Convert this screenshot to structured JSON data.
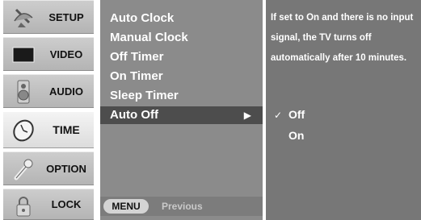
{
  "sidebar": {
    "items": [
      {
        "label": "SETUP",
        "icon": "satellite-dish-icon"
      },
      {
        "label": "VIDEO",
        "icon": "tv-screen-icon"
      },
      {
        "label": "AUDIO",
        "icon": "speaker-icon"
      },
      {
        "label": "TIME",
        "icon": "clock-icon",
        "selected": true
      },
      {
        "label": "OPTION",
        "icon": "wrench-icon"
      },
      {
        "label": "LOCK",
        "icon": "padlock-icon"
      }
    ]
  },
  "menu": {
    "items": [
      {
        "label": "Auto Clock"
      },
      {
        "label": "Manual Clock"
      },
      {
        "label": "Off Timer"
      },
      {
        "label": "On Timer"
      },
      {
        "label": "Sleep Timer"
      },
      {
        "label": "Auto Off",
        "active": true,
        "arrow": "▶"
      }
    ],
    "footer": {
      "menu_key": "MENU",
      "action": "Previous"
    }
  },
  "info": {
    "description": "If set to On and there is no input signal, the TV turns off automatically after 10 minutes.",
    "options": [
      {
        "label": "Off",
        "checked": true,
        "check_mark": "✓"
      },
      {
        "label": "On",
        "checked": false,
        "check_mark": ""
      }
    ]
  },
  "colors": {
    "menu_panel": "#8b8b8b",
    "active_row": "#4d4d4d",
    "info_panel": "#777777"
  }
}
